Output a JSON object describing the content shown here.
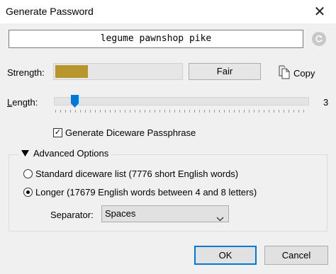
{
  "window": {
    "title": "Generate Password",
    "close_glyph": "✕"
  },
  "password": {
    "value": "legume pawnshop pike"
  },
  "icons": {
    "refresh": "refresh-icon",
    "copy": "copy-icon",
    "close": "close-icon",
    "expand": "triangle-down-icon",
    "dropdown": "chevron-down-icon"
  },
  "strength": {
    "label": "Strength:",
    "rating": "Fair",
    "level": 0.27,
    "color": "#b8962e"
  },
  "copy_button": {
    "label": "Copy"
  },
  "length": {
    "label": "Length:",
    "value": "3",
    "min": 1,
    "max": 50,
    "current": 3
  },
  "diceware": {
    "label": "Generate Diceware Passphrase",
    "checked": true
  },
  "advanced": {
    "label": "Advanced Options",
    "options": [
      {
        "label": "Standard diceware list (7776 short English words)",
        "selected": false
      },
      {
        "label": "Longer (17679 English words between 4 and 8 letters)",
        "selected": true
      }
    ],
    "separator": {
      "label": "Separator:",
      "value": "Spaces"
    }
  },
  "buttons": {
    "ok": "OK",
    "cancel": "Cancel"
  },
  "colors": {
    "accent": "#0078d7",
    "dialog_bg": "#f0f0f0"
  }
}
